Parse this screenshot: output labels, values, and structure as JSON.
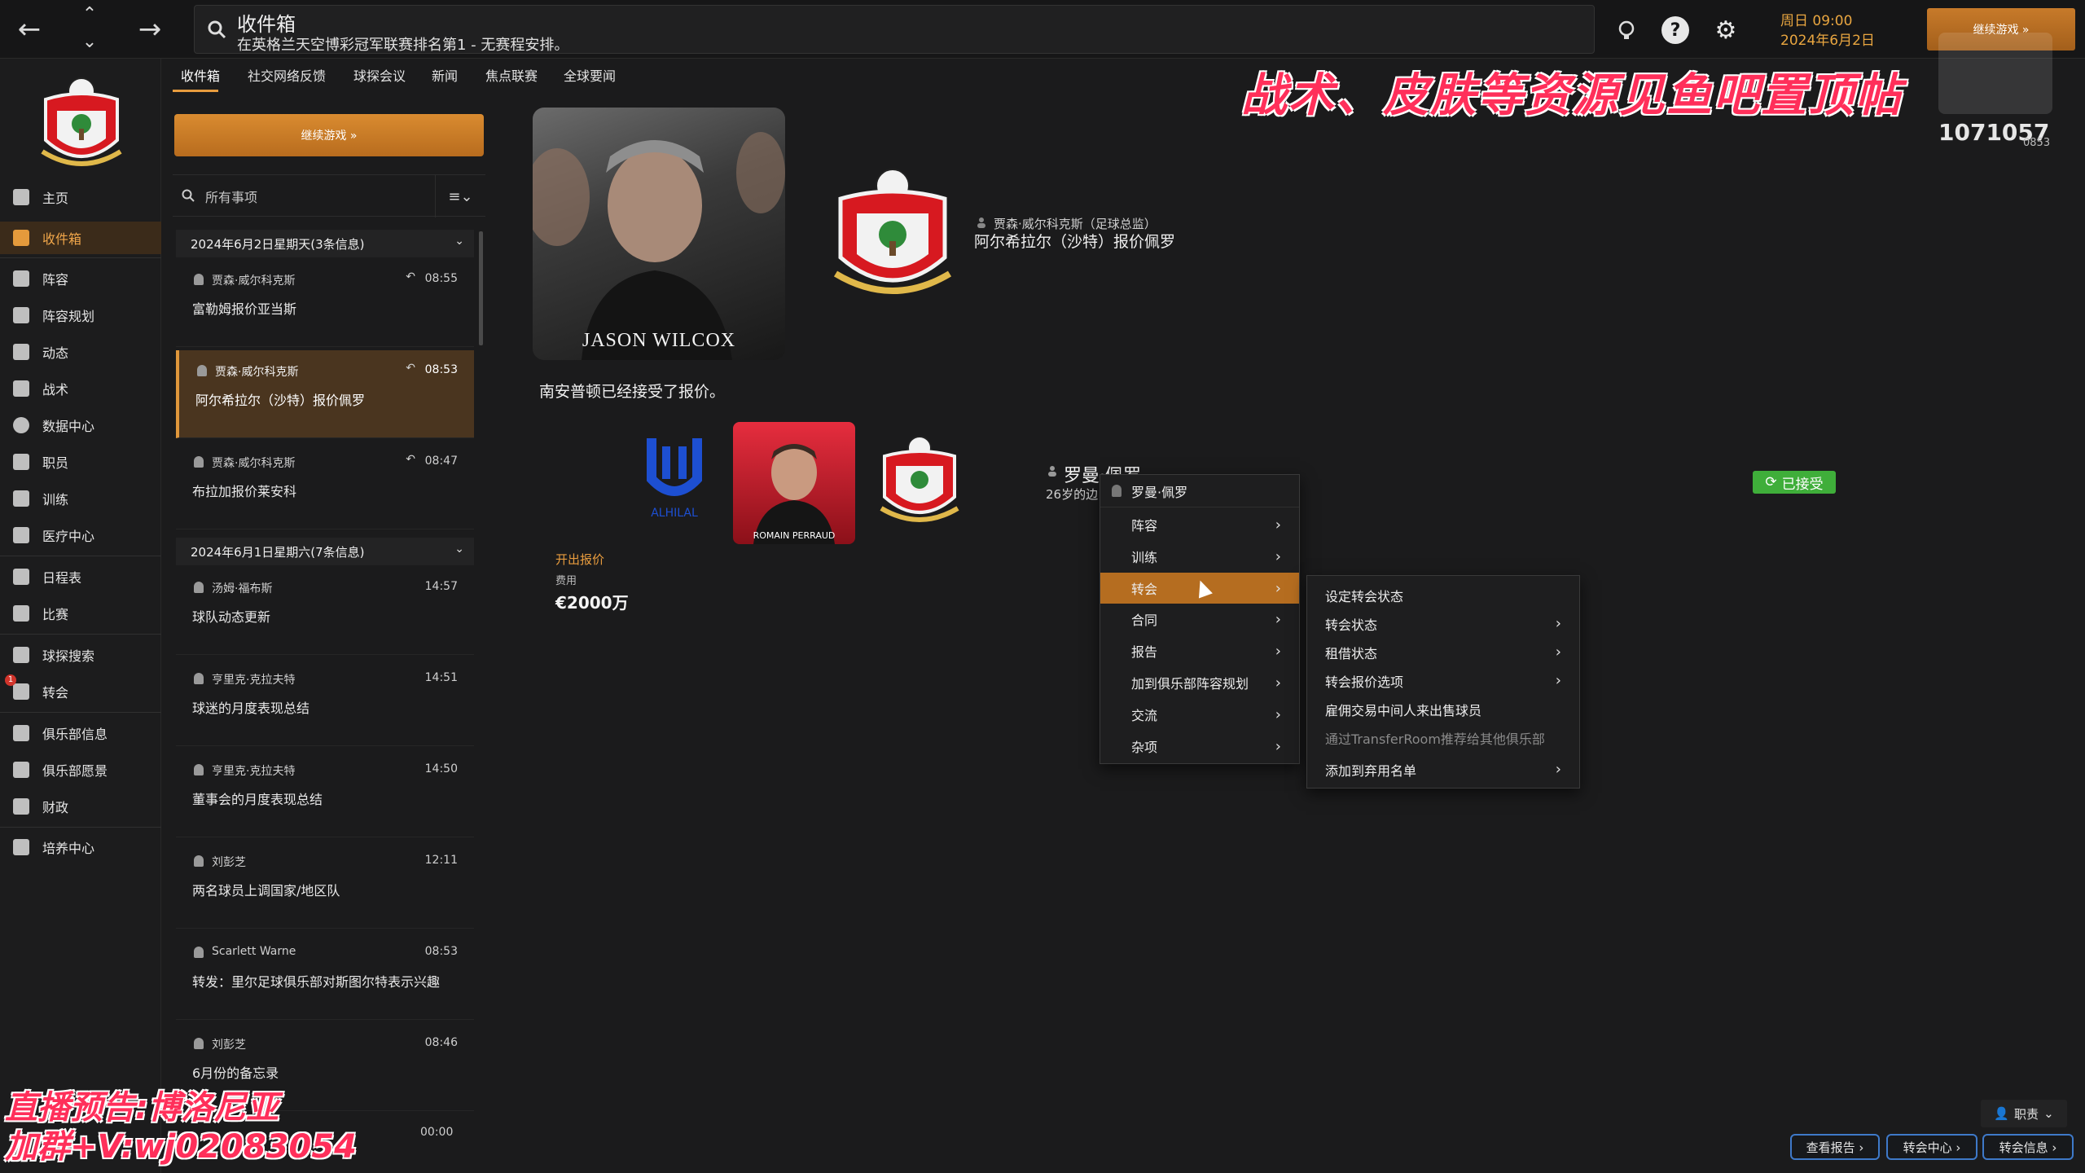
{
  "topbar": {
    "back": "←",
    "up": "⌃",
    "down": "⌄",
    "forward": "→",
    "search_title": "收件箱",
    "search_subtitle": "在英格兰天空博彩冠军联赛排名第1 - 无赛程安排。",
    "date_line1": "周日 09:00",
    "date_line2": "2024年6月2日",
    "continue_label": "继续游戏 »",
    "score": "1071057",
    "score_small": "0853"
  },
  "sidebar": {
    "items": [
      {
        "label": "主页"
      },
      {
        "label": "收件箱"
      },
      {
        "label": "阵容"
      },
      {
        "label": "阵容规划"
      },
      {
        "label": "动态"
      },
      {
        "label": "战术"
      },
      {
        "label": "数据中心"
      },
      {
        "label": "职员"
      },
      {
        "label": "训练"
      },
      {
        "label": "医疗中心"
      },
      {
        "label": "日程表"
      },
      {
        "label": "比赛"
      },
      {
        "label": "球探搜索"
      },
      {
        "label": "转会"
      },
      {
        "label": "俱乐部信息"
      },
      {
        "label": "俱乐部愿景"
      },
      {
        "label": "财政"
      },
      {
        "label": "培养中心"
      }
    ],
    "transfer_badge": "1"
  },
  "inbox": {
    "tabs": [
      "收件箱",
      "社交网络反馈",
      "球探会议",
      "新闻",
      "焦点联赛",
      "全球要闻"
    ],
    "continue_label": "继续游戏  »",
    "filter_label": "所有事项",
    "filter_sort": "≡⌄",
    "groups": [
      {
        "header": "2024年6月2日星期天(3条信息)",
        "messages": [
          {
            "sender": "贾森·威尔科克斯",
            "time": "08:55",
            "reply": "↶",
            "subject": "富勒姆报价亚当斯"
          },
          {
            "sender": "贾森·威尔科克斯",
            "time": "08:53",
            "reply": "↶",
            "subject": "阿尔希拉尔（沙特）报价佩罗"
          },
          {
            "sender": "贾森·威尔科克斯",
            "time": "08:47",
            "reply": "↶",
            "subject": "布拉加报价莱安科"
          }
        ]
      },
      {
        "header": "2024年6月1日星期六(7条信息)",
        "messages": [
          {
            "sender": "汤姆·福布斯",
            "time": "14:57",
            "subject": "球队动态更新"
          },
          {
            "sender": "亨里克·克拉夫特",
            "time": "14:51",
            "subject": "球迷的月度表现总结"
          },
          {
            "sender": "亨里克·克拉夫特",
            "time": "14:50",
            "subject": "董事会的月度表现总结"
          },
          {
            "sender": "刘彭芝",
            "time": "12:11",
            "subject": "两名球员上调国家/地区队"
          },
          {
            "sender": "Scarlett Warne",
            "time": "08:53",
            "subject": "转发：里尔足球俱乐部对斯图尔特表示兴趣"
          },
          {
            "sender": "刘彭芝",
            "time": "08:46",
            "subject": "6月份的备忘录"
          }
        ]
      }
    ]
  },
  "mail": {
    "staff_photo_name": "JASON WILCOX",
    "from": "贾森·威尔科克斯（足球总监）",
    "subject": "阿尔希拉尔（沙特）报价佩罗",
    "body_line": "南安普顿已经接受了报价。",
    "buyer_logo_text": "ALHILAL",
    "player_photo_name": "ROMAIN PERRAUD",
    "player_name": "罗曼·佩罗",
    "player_age": "26岁的边",
    "accepted_label": "已接受",
    "offer_label": "开出报价",
    "fee_label": "费用",
    "fee_value": "€2000万"
  },
  "context_menu": {
    "title": "罗曼·佩罗",
    "items": [
      "阵容",
      "训练",
      "转会",
      "合同",
      "报告",
      "加到俱乐部阵容规划",
      "交流",
      "杂项"
    ],
    "highlighted_index": 2
  },
  "sub_menu": {
    "items": [
      {
        "label": "设定转会状态",
        "arrow": false,
        "disabled": false
      },
      {
        "label": "转会状态",
        "arrow": true,
        "disabled": false
      },
      {
        "label": "租借状态",
        "arrow": true,
        "disabled": false
      },
      {
        "label": "转会报价选项",
        "arrow": true,
        "disabled": false
      },
      {
        "label": "雇佣交易中间人来出售球员",
        "arrow": false,
        "disabled": false
      },
      {
        "label": "通过TransferRoom推荐给其他俱乐部",
        "arrow": false,
        "disabled": true
      },
      {
        "label": "添加到弃用名单",
        "arrow": true,
        "disabled": false
      }
    ]
  },
  "bottom": {
    "role_label": "职责",
    "buttons": [
      "查看报告 ›",
      "转会中心 ›",
      "转会信息 ›"
    ]
  },
  "overlay": {
    "banner": "战术、皮肤等资源见鱼吧置顶帖",
    "line1": "直播预告:博洛尼亚",
    "line2": "加群+V:wj02083054",
    "time": "00:00"
  },
  "colors": {
    "accent": "#e89c3e",
    "highlight": "#b56d20",
    "accepted": "#3fae3a",
    "link_border": "#3e79c9",
    "overlay_red": "#ff2f5a"
  }
}
